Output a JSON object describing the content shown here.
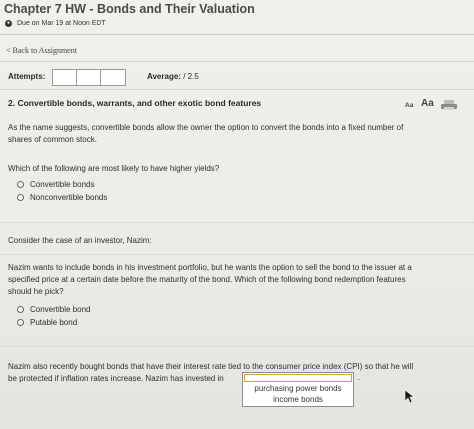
{
  "header": {
    "title": "Chapter 7 HW - Bonds and Their Valuation",
    "due": "Due on Mar 19 at Noon EDT",
    "due_icon": "clock-icon"
  },
  "nav": {
    "back_label": "< Back to Assignment"
  },
  "stats": {
    "attempts_label": "Attempts:",
    "average_label": "Average:",
    "average_value": "/ 2.5"
  },
  "question": {
    "heading": "2. Convertible bonds, warrants, and other exotic bond features",
    "font_small": "Aa",
    "font_large": "Aa",
    "intro_line1": "As the name suggests, convertible bonds allow the owner the option to convert the bonds into a fixed number of",
    "intro_line2": "shares of common stock.",
    "q1": "Which of the following are most likely to have higher yields?",
    "q1_options": [
      "Convertible bonds",
      "Nonconvertible bonds"
    ],
    "case_intro": "Consider the case of an investor, Nazim:",
    "case_line1": "Nazim wants to include bonds in his investment portfolio, but he wants the option to sell the bond to the issuer at a",
    "case_line2": "specified price at a certain date before the maturity of the bond. Which of the following bond redemption features",
    "case_line3": "should he pick?",
    "q2_options": [
      "Convertible bond",
      "Putable bond"
    ],
    "final_line1": "Nazim also recently bought bonds that have their interest rate tied to the consumer price index (CPI) so that he will",
    "final_line2": "be protected if inflation rates increase. Nazim has invested in",
    "final_period": ".",
    "dropdown_options": [
      "purchasing power bonds",
      "income bonds"
    ]
  }
}
